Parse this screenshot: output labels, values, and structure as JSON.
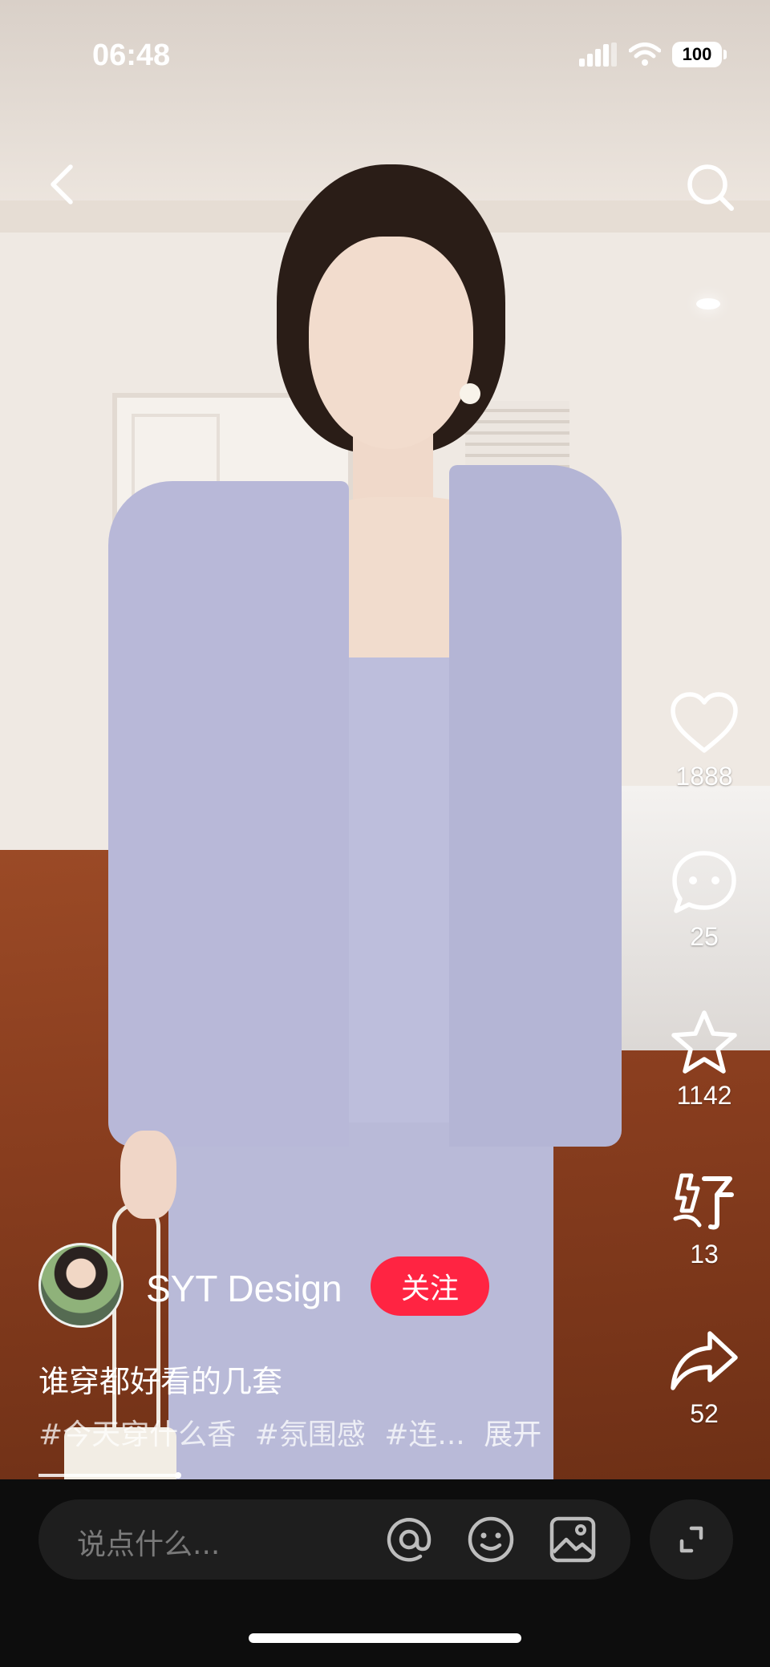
{
  "status_bar": {
    "time": "06:48",
    "battery": "100",
    "icons": [
      "signal-icon",
      "wifi-icon",
      "battery-icon"
    ]
  },
  "nav": {
    "back_icon": "chevron-left-icon",
    "search_icon": "search-icon"
  },
  "actions": {
    "like_count": "1888",
    "comment_count": "25",
    "collect_count": "1142",
    "gift_count": "13",
    "share_count": "52"
  },
  "author": {
    "name": "SYT Design",
    "follow_label": "关注"
  },
  "post": {
    "caption": "谁穿都好看的几套",
    "tags": [
      "#今天穿什么香",
      "#氛围感",
      "#连..."
    ],
    "expand_label": "展开"
  },
  "comment_bar": {
    "placeholder": "说点什么...",
    "icons": [
      "at-icon",
      "emoji-icon",
      "image-icon",
      "fullscreen-icon"
    ]
  },
  "colors": {
    "accent": "#ff2442",
    "bar_bg": "#0d0d0d",
    "input_bg": "#1e1e1e"
  }
}
